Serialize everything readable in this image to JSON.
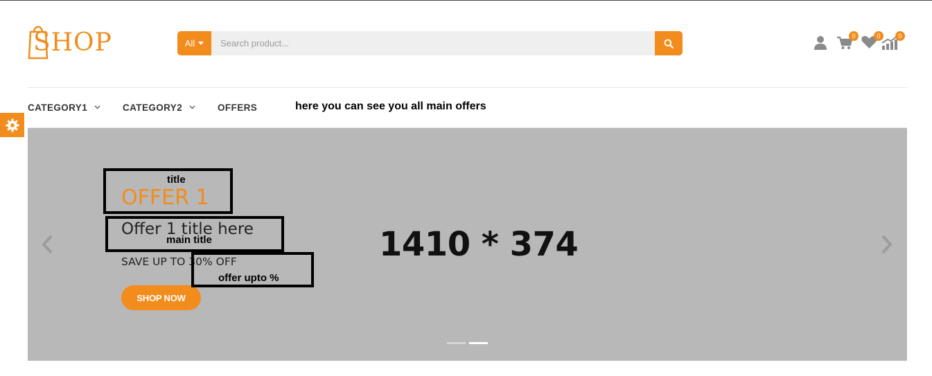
{
  "header": {
    "logo_text": "SHOP",
    "search": {
      "category": "All",
      "placeholder": "Search product..."
    },
    "icons": {
      "user": "user-icon",
      "cart": "cart-icon",
      "wishlist": "heart-icon",
      "compare": "compare-icon"
    },
    "cart_count": "0",
    "wishlist_count": "0",
    "compare_count": "0"
  },
  "nav": {
    "items": [
      {
        "label": "CATEGORY1"
      },
      {
        "label": "CATEGORY2"
      },
      {
        "label": "OFFERS"
      }
    ],
    "note": "here you can see you all main offers"
  },
  "slider": {
    "offer_label": "OFFER 1",
    "offer_title": "Offer 1 title here",
    "offer_save": "SAVE UP TO 30% OFF",
    "button_label": "SHOP NOW",
    "dimensions_text": "1410 * 374",
    "active_dot": 2
  },
  "annotations": {
    "title": "title",
    "main_title": "main title",
    "offer_upto": "offer upto %"
  },
  "colors": {
    "accent": "#f28c1c",
    "slider_bg": "#b8b8b8"
  }
}
